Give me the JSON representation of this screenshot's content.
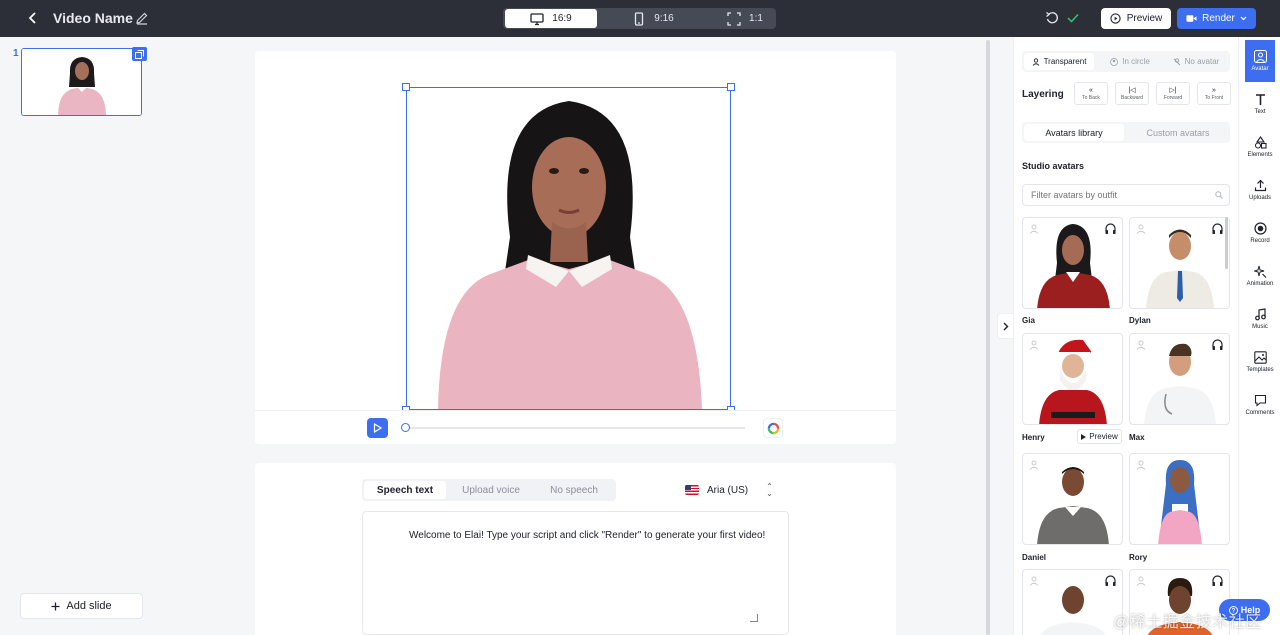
{
  "topbar": {
    "title": "Video Name",
    "ratios": [
      {
        "label": "16:9",
        "active": true,
        "icon": "monitor-icon"
      },
      {
        "label": "9:16",
        "active": false,
        "icon": "phone-icon"
      },
      {
        "label": "1:1",
        "active": false,
        "icon": "square-frame-icon"
      }
    ],
    "preview_label": "Preview",
    "render_label": "Render"
  },
  "slides": {
    "items": [
      {
        "number": "1"
      }
    ],
    "add_label": "Add slide"
  },
  "script": {
    "tabs": [
      "Speech text",
      "Upload voice",
      "No speech"
    ],
    "active_tab": "Speech text",
    "voice": "Aria (US)",
    "text": "Welcome to Elai! Type your script and click \"Render\" to generate your first video!"
  },
  "panel": {
    "background_tabs": [
      "Transparent",
      "In circle",
      "No avatar"
    ],
    "layering_label": "Layering",
    "layer_buttons": [
      "To Back",
      "Backward",
      "Forward",
      "To Front"
    ],
    "library_tabs": [
      "Avatars library",
      "Custom avatars"
    ],
    "section_label": "Studio avatars",
    "filter_placeholder": "Filter avatars by outfit",
    "avatars": [
      "Gia",
      "Dylan",
      "Henry",
      "Max",
      "Daniel",
      "Rory",
      "",
      ""
    ],
    "card_preview_label": "Preview"
  },
  "rail": {
    "items": [
      "Avatar",
      "Text",
      "Elements",
      "Uploads",
      "Record",
      "Animation",
      "Music",
      "Templates",
      "Comments"
    ]
  },
  "help_label": "Help",
  "watermark": "@稀土掘金技术社区",
  "colors": {
    "accent": "#3d6ef0",
    "topbar": "#2c2f38",
    "success": "#33c46c"
  }
}
